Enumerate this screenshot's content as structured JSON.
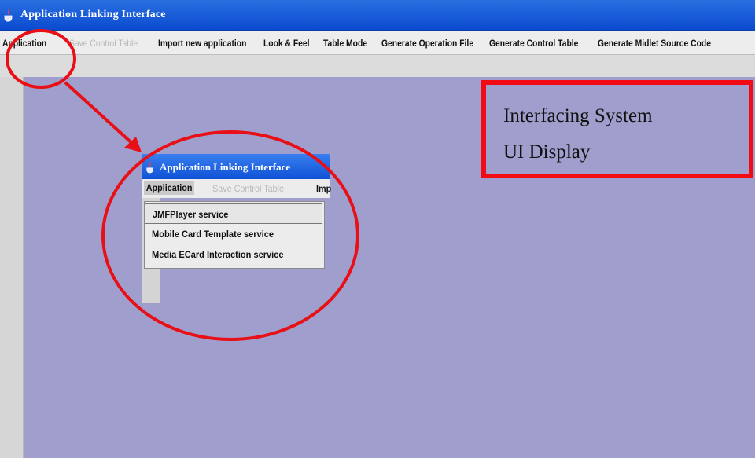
{
  "window": {
    "title": "Application Linking Interface",
    "icon": "java-cup-icon"
  },
  "menubar": {
    "items": [
      {
        "label": "Application",
        "enabled": true
      },
      {
        "label": "Save Control Table",
        "enabled": false
      },
      {
        "label": "Import new application",
        "enabled": true
      },
      {
        "label": "Look & Feel",
        "enabled": true
      },
      {
        "label": "Table Mode",
        "enabled": true
      },
      {
        "label": "Generate Operation File",
        "enabled": true
      },
      {
        "label": "Generate Control Table",
        "enabled": true
      },
      {
        "label": "Generate Midlet Source Code",
        "enabled": true
      }
    ]
  },
  "inner_window": {
    "title": "Application Linking Interface",
    "menubar": [
      {
        "label": "Application",
        "selected": true
      },
      {
        "label": "Save Control Table",
        "enabled": false
      },
      {
        "label": "Imp"
      }
    ],
    "dropdown": [
      {
        "label": "JMFPlayer service"
      },
      {
        "label": "Mobile Card Template service"
      },
      {
        "label": "Media ECard Interaction service"
      }
    ]
  },
  "callout": {
    "line1": "Interfacing System",
    "line2": "UI Display"
  },
  "colors": {
    "titlebar": "#0b4bd0",
    "desktop": "#a09ecc",
    "annotation": "#f20a14"
  }
}
